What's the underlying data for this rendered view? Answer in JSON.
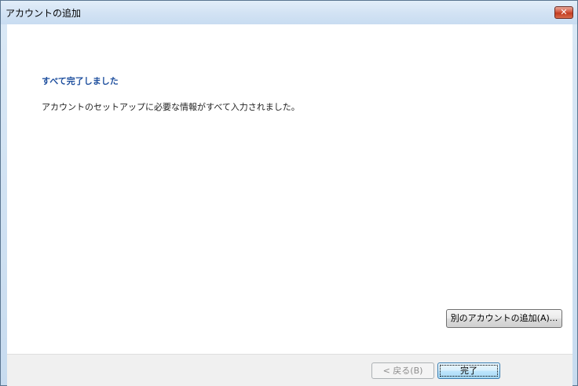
{
  "window": {
    "title": "アカウントの追加",
    "close_glyph": "✕"
  },
  "content": {
    "heading": "すべて完了しました",
    "message": "アカウントのセットアップに必要な情報がすべて入力されました。",
    "add_account_button": "別のアカウントの追加(A)..."
  },
  "footer": {
    "back_button": "< 戻る(B)",
    "finish_button": "完了"
  },
  "colors": {
    "heading": "#1e4f9e",
    "close_button": "#c23b20",
    "frame": "#c7dbef"
  }
}
